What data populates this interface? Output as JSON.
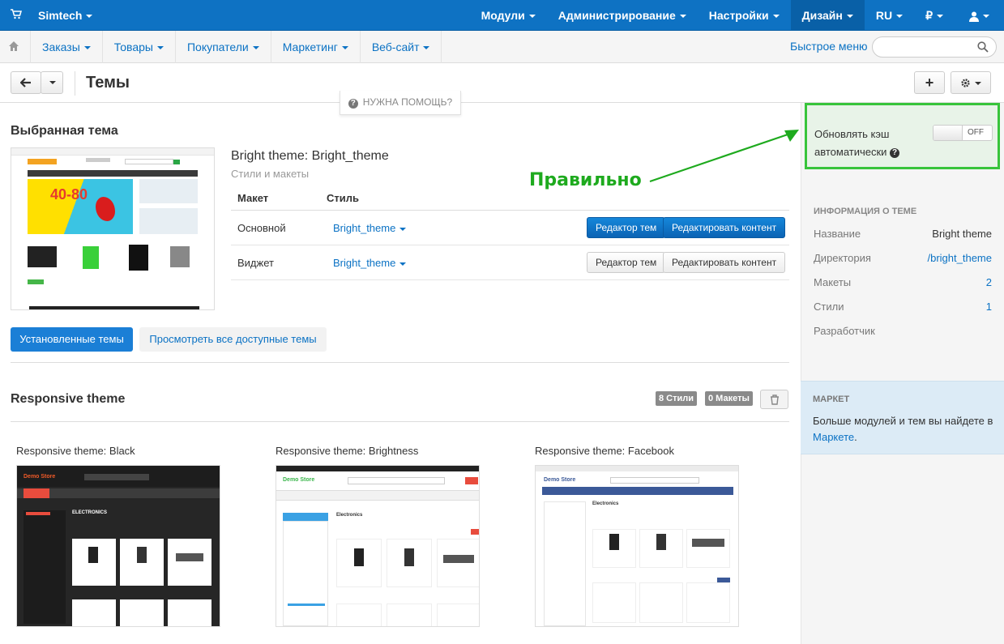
{
  "topbar": {
    "brand": "Simtech",
    "menu": [
      "Модули",
      "Администрирование",
      "Настройки",
      "Дизайн",
      "RU",
      "₽"
    ],
    "active": "Дизайн"
  },
  "navbar": {
    "items": [
      "Заказы",
      "Товары",
      "Покупатели",
      "Маркетинг",
      "Веб-сайт"
    ],
    "quick_menu": "Быстрое меню",
    "search_placeholder": ""
  },
  "header": {
    "title": "Темы"
  },
  "help": "НУЖНА ПОМОЩЬ?",
  "sidebar": {
    "cache_label_1": "Обновлять кэш",
    "cache_label_2": "автоматически",
    "cache_toggle": "OFF",
    "info_title": "ИНФОРМАЦИЯ О ТЕМЕ",
    "info": [
      {
        "k": "Название",
        "v": "Bright theme",
        "link": false
      },
      {
        "k": "Директория",
        "v": "/bright_theme",
        "link": true
      },
      {
        "k": "Макеты",
        "v": "2",
        "link": true
      },
      {
        "k": "Стили",
        "v": "1",
        "link": true
      },
      {
        "k": "Разработчик",
        "v": "",
        "link": false
      }
    ],
    "market_title": "МАРКЕТ",
    "market_text": "Больше модулей и тем вы найдете в",
    "market_link": "Маркете",
    "market_after": "."
  },
  "selected": {
    "heading": "Выбранная тема",
    "name": "Bright theme: Bright_theme",
    "sub": "Стили и макеты",
    "col_layout": "Макет",
    "col_style": "Стиль",
    "rows": [
      {
        "layout": "Основной",
        "style": "Bright_theme",
        "edit_themes": "Редактор тем",
        "edit_content": "Редактировать контент",
        "primary": true
      },
      {
        "layout": "Виджет",
        "style": "Bright_theme",
        "edit_themes": "Редактор тем",
        "edit_content": "Редактировать контент",
        "primary": false
      }
    ],
    "thumb_banner": "40-80"
  },
  "tabs": {
    "installed": "Установленные темы",
    "all": "Просмотреть все доступные темы"
  },
  "responsive": {
    "heading": "Responsive theme",
    "styles_badge": "8 Стили",
    "layouts_badge": "0 Макеты",
    "styles": [
      {
        "name": "Responsive theme: Black",
        "store": "Demo Store",
        "category": "ELECTRONICS"
      },
      {
        "name": "Responsive theme: Brightness",
        "store": "Demo Store",
        "category": "Electronics"
      },
      {
        "name": "Responsive theme: Facebook",
        "store": "Demo Store",
        "category": "Electronics"
      }
    ]
  },
  "annotation": "Правильно",
  "colors": {
    "primary": "#0e72c3",
    "annotation": "#1eaa1e",
    "cache_border": "#38c43b"
  }
}
